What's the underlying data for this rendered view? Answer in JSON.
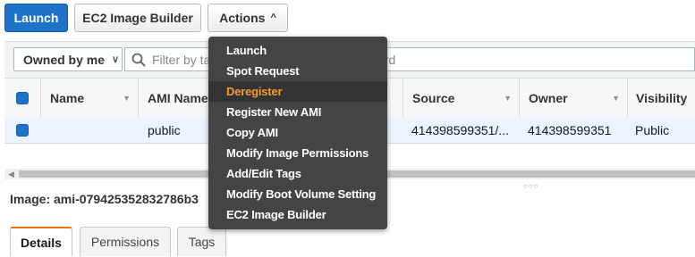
{
  "toolbar": {
    "launch_label": "Launch",
    "builder_label": "EC2 Image Builder",
    "actions_label": "Actions",
    "actions_caret": "^"
  },
  "filter": {
    "owned_label": "Owned by me",
    "search_placeholder_left": "Filter by ta",
    "search_placeholder_right": "vord"
  },
  "table": {
    "columns": [
      "Name",
      "AMI Name",
      "Source",
      "Owner",
      "Visibility"
    ],
    "rows": [
      {
        "name": "",
        "ami_name": "public",
        "source": "414398599351/...",
        "owner": "414398599351",
        "visibility": "Public"
      }
    ]
  },
  "detail": {
    "title": "Image: ami-079425352832786b3",
    "tabs": [
      "Details",
      "Permissions",
      "Tags"
    ],
    "active_tab": "Details"
  },
  "actions_menu": {
    "items": [
      "Launch",
      "Spot Request",
      "Deregister",
      "Register New AMI",
      "Copy AMI",
      "Modify Image Permissions",
      "Add/Edit Tags",
      "Modify Boot Volume Setting",
      "EC2 Image Builder"
    ],
    "highlighted": "Deregister"
  },
  "colors": {
    "primary": "#1e73c8",
    "menu_bg": "#444444",
    "menu_highlight_text": "#f19b30",
    "row_selected": "#eaf3fe"
  }
}
